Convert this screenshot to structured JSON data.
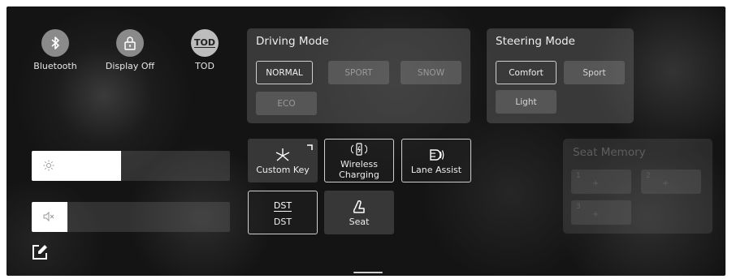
{
  "quick_toggles": {
    "bluetooth": {
      "label": "Bluetooth",
      "icon": "bluetooth-icon"
    },
    "display_off": {
      "label": "Display Off",
      "icon": "lock-icon"
    },
    "tod": {
      "label": "TOD",
      "icon_text": "TOD"
    }
  },
  "driving_mode": {
    "title": "Driving Mode",
    "options": [
      "NORMAL",
      "SPORT",
      "SNOW",
      "ECO"
    ],
    "selected": "NORMAL"
  },
  "steering_mode": {
    "title": "Steering Mode",
    "options": [
      "Comfort",
      "Sport",
      "Light"
    ],
    "selected": "Comfort"
  },
  "tiles": {
    "custom_key": {
      "label": "Custom Key",
      "icon": "asterisk-icon"
    },
    "wireless_charging": {
      "label_line1": "Wireless",
      "label_line2": "Charging",
      "icon": "phone-charging-icon"
    },
    "lane_assist": {
      "label": "Lane Assist",
      "icon": "lane-assist-icon"
    },
    "dst": {
      "label": "DST",
      "icon_text": "DST"
    },
    "seat": {
      "label": "Seat",
      "icon": "seat-icon"
    }
  },
  "sliders": {
    "brightness": {
      "icon": "sun-icon",
      "level": 0.45
    },
    "volume": {
      "icon": "mute-icon",
      "level": 0.18
    }
  },
  "seat_memory": {
    "title": "Seat Memory",
    "slots": [
      {
        "num": "1",
        "symbol": "+"
      },
      {
        "num": "2",
        "symbol": "+"
      },
      {
        "num": "3",
        "symbol": "+"
      }
    ]
  },
  "colors": {
    "background": "#141414",
    "panel": "#6e6e6e",
    "selected_border": "#cfcfcf",
    "text": "#eeeeee"
  }
}
